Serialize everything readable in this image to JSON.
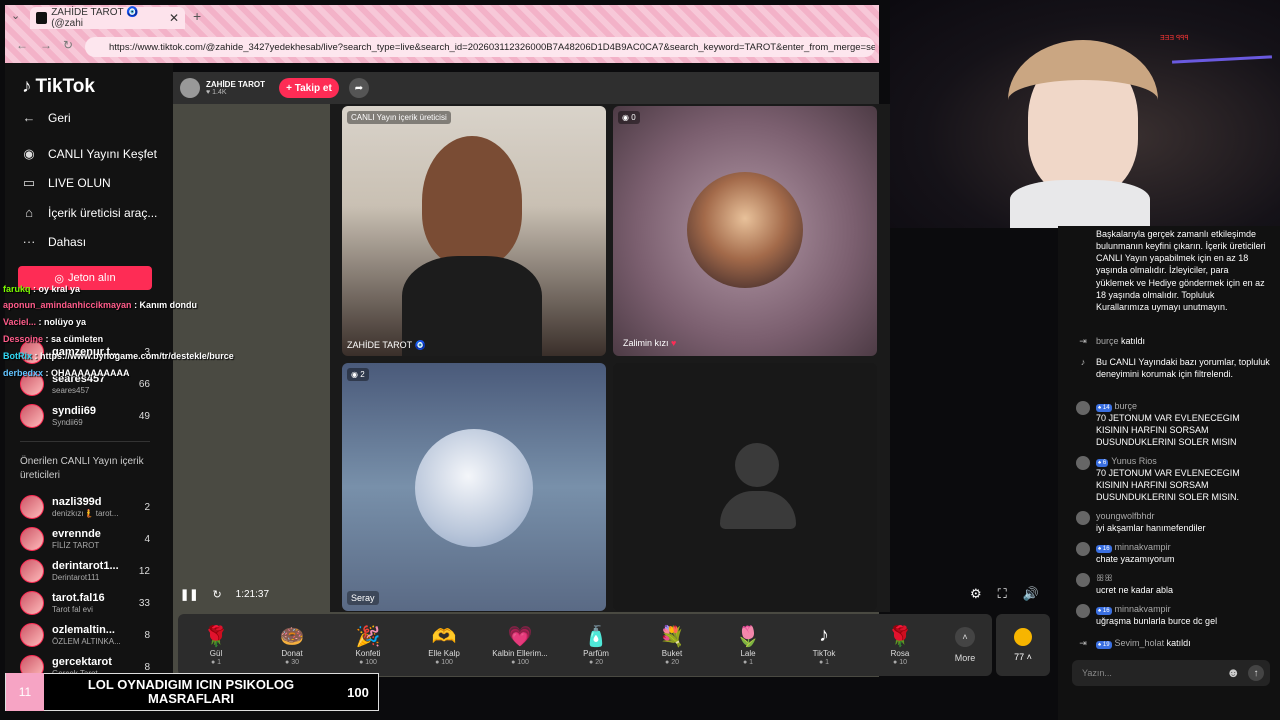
{
  "browser": {
    "tab_title": "ZAHİDE TAROT 🧿 (@zahi",
    "url": "https://www.tiktok.com/@zahide_3427yedekhesab/live?search_type=live&search_id=202603112326000B7A48206D1D4B9AC0CA7&search_keyword=TAROT&enter_from_merge=search_resu"
  },
  "sidebar": {
    "logo": "TikTok",
    "back": "Geri",
    "nav": [
      "CANLI Yayını Keşfet",
      "LIVE OLUN",
      "İçerik üreticisi araç...",
      "Dahası"
    ],
    "jeton_button": "Jeton alın",
    "following_accounts": [
      {
        "name": "gamzenur.t...",
        "sub": "",
        "count": "3"
      },
      {
        "name": "seares457",
        "sub": "seares457",
        "count": "66"
      },
      {
        "name": "syndii69",
        "sub": "Syndii69",
        "count": "49"
      }
    ],
    "suggested_title": "Önerilen CANLI Yayın içerik üreticileri",
    "suggested_accounts": [
      {
        "name": "nazli399d",
        "sub": "denizkızı🧜 tarot...",
        "count": "2"
      },
      {
        "name": "evrennde",
        "sub": "FİLİZ TAROT",
        "count": "4"
      },
      {
        "name": "derintarot1...",
        "sub": "Derintarot111",
        "count": "12"
      },
      {
        "name": "tarot.fal16",
        "sub": "Tarot fal evi",
        "count": "33"
      },
      {
        "name": "ozlemaltin...",
        "sub": "ÖZLEM ALTINKA...",
        "count": "8"
      },
      {
        "name": "gercektarot",
        "sub": "Gerçek Tarot",
        "count": "8"
      }
    ]
  },
  "header": {
    "host_name": "ZAHİDE TAROT",
    "host_likes": "1.4K",
    "follow_label": "+ Takip et"
  },
  "tiles": {
    "t1_tag": "CANLI Yayın içerik üreticisi",
    "t1_name": "ZAHİDE TAROT 🧿",
    "t2_tag": "0",
    "t2_name": "Zalimin kızı",
    "t3_tag": "2",
    "t3_name": "Seray"
  },
  "controls": {
    "time": "1:21:37"
  },
  "gifts": [
    {
      "name": "Gül",
      "price": "1",
      "icon": "🌹"
    },
    {
      "name": "Donat",
      "price": "30",
      "icon": "🍩"
    },
    {
      "name": "Konfeti",
      "price": "100",
      "icon": "🎉"
    },
    {
      "name": "Elle Kalp",
      "price": "100",
      "icon": "🫶"
    },
    {
      "name": "Kalbin Ellerim...",
      "price": "100",
      "icon": "💗"
    },
    {
      "name": "Parfüm",
      "price": "20",
      "icon": "🧴"
    },
    {
      "name": "Buket",
      "price": "20",
      "icon": "💐"
    },
    {
      "name": "Lale",
      "price": "1",
      "icon": "🌷"
    },
    {
      "name": "TikTok",
      "price": "1",
      "icon": "♪"
    },
    {
      "name": "Rosa",
      "price": "10",
      "icon": "🌹"
    }
  ],
  "more_label": "More",
  "coin_count": "77",
  "overlay_chat": [
    {
      "user": "farukq",
      "text": ": oy kral ya",
      "color": "#7cfc00"
    },
    {
      "user": "aponun_amindanhiccikmayan",
      "text": ": Kanım dondu",
      "color": "#ff5c8a"
    },
    {
      "user": "Vaciel...",
      "text": ": nolüyo ya",
      "color": "#ff5c8a"
    },
    {
      "user": "Dessoine",
      "text": ": sa cümleten",
      "color": "#ff5c8a"
    },
    {
      "user": "BotRix",
      "text": ": https://www.bynogame.com/tr/destekle/burce",
      "color": "#31d9f5"
    },
    {
      "user": "derbedxx",
      "text": ": OHAAAAAAAAAA",
      "color": "#62c3ff"
    }
  ],
  "chat": {
    "welcome": "Başkalarıyla gerçek zamanlı etkileşimde bulunmanın keyfini çıkarın. İçerik üreticileri CANLI Yayın yapabilmek için en az 18 yaşında olmalıdır. İzleyiciler, para yüklemek ve Hediye göndermek için en az 18 yaşında olmalıdır. Topluluk Kurallarımıza uymayı unutmayın.",
    "join1_user": "burçe",
    "join1_text": "katıldı",
    "filter_notice": "Bu CANLI Yayındaki bazı yorumlar, topluluk deneyimini korumak için filtrelendi.",
    "messages": [
      {
        "badge": "14",
        "user": "burçe",
        "text": "70 JETONUM VAR EVLENECEGIM KISININ HARFINI SORSAM DUSUNDUKLERINI SOLER MISIN"
      },
      {
        "badge": "6",
        "user": "Yunus Rios",
        "text": "70 JETONUM VAR EVLENECEGIM KISININ HARFINI SORSAM DUSUNDUKLERINI SOLER MISIN."
      },
      {
        "badge": "",
        "user": "youngwolfbhdr",
        "text": "iyi akşamlar hanımefendiler"
      },
      {
        "badge": "16",
        "user": "minnakvampir",
        "text": "chate yazamıyorum"
      },
      {
        "badge": "",
        "user": "ꕥꕥ",
        "text": "ucret ne kadar abla"
      },
      {
        "badge": "16",
        "user": "minnakvampir",
        "text": "uğraşma bunlarla burce dc gel"
      }
    ],
    "join2_badge": "19",
    "join2_user": "Sevim_holat",
    "join2_text": "katıldı",
    "input_placeholder": "Yazın..."
  },
  "goal": {
    "number": "11",
    "text": "LOL OYNADIGIM ICIN PSIKOLOG MASRAFLARI",
    "value": "100"
  },
  "webcam_text": "ƎƎƎ ꟼꟼꟼ"
}
